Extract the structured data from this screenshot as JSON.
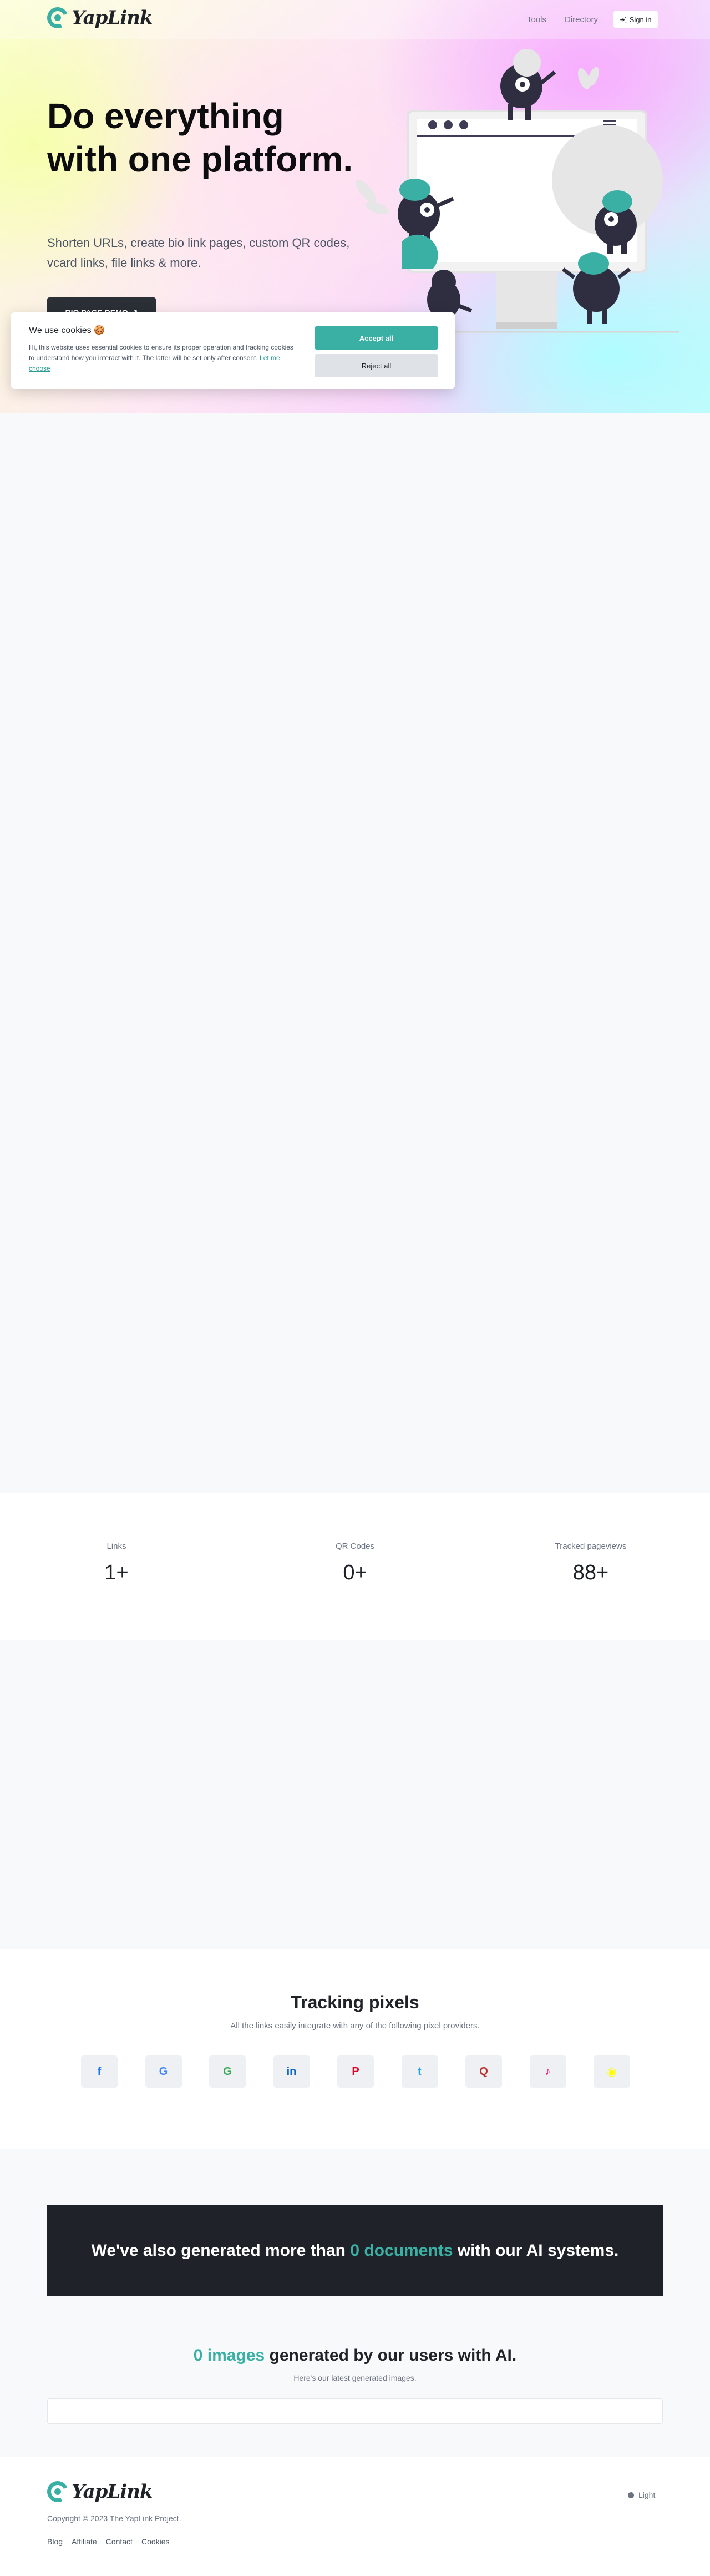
{
  "brand": {
    "name": "YapLink",
    "accent_color": "#3ab0a4",
    "dark_color": "#1f2329"
  },
  "nav": {
    "tools": "Tools",
    "directory": "Directory",
    "signin_icon": "sign-in-icon",
    "signin": "Sign in"
  },
  "hero": {
    "title": "Do everything with one platform.",
    "subtitle": "Shorten URLs, create bio link pages, custom QR codes, vcard links, file links & more.",
    "demo_button": "BIO PAGE DEMO",
    "demo_icon": "external-link-icon"
  },
  "cookie": {
    "title": "We use cookies 🍪",
    "text": "Hi, this website uses essential cookies to ensure its proper operation and tracking cookies to understand how you interact with it. The latter will be set only after consent.",
    "link": "Let me choose",
    "accept": "Accept all",
    "reject": "Reject all"
  },
  "stats": [
    {
      "label": "Links",
      "value": "1+"
    },
    {
      "label": "QR Codes",
      "value": "0+"
    },
    {
      "label": "Tracked pageviews",
      "value": "88+"
    }
  ],
  "pixels": {
    "title": "Tracking pixels",
    "subtitle": "All the links easily integrate with any of the following pixel providers.",
    "providers": [
      {
        "name": "facebook-icon",
        "glyph": "f",
        "color": "#1877f2"
      },
      {
        "name": "google-analytics-icon",
        "glyph": "G",
        "color": "#4285f4"
      },
      {
        "name": "google-tag-manager-icon",
        "glyph": "G",
        "color": "#34a853"
      },
      {
        "name": "linkedin-icon",
        "glyph": "in",
        "color": "#0a66c2"
      },
      {
        "name": "pinterest-icon",
        "glyph": "P",
        "color": "#e60023"
      },
      {
        "name": "twitter-icon",
        "glyph": "t",
        "color": "#1da1f2"
      },
      {
        "name": "quora-icon",
        "glyph": "Q",
        "color": "#b92b27"
      },
      {
        "name": "tiktok-icon",
        "glyph": "♪",
        "color": "#ff0050"
      },
      {
        "name": "snapchat-icon",
        "glyph": "◉",
        "color": "#fffc00"
      }
    ]
  },
  "ai": {
    "documents_pre": "We've also generated more than",
    "documents_count": "0 documents",
    "documents_post": "with our AI systems.",
    "images_count": "0 images",
    "images_post": "generated by our users with AI.",
    "images_sub": "Here's our latest generated images."
  },
  "footer": {
    "copyright": "Copyright © 2023 The YapLink Project.",
    "links": [
      "Blog",
      "Affiliate",
      "Contact",
      "Cookies"
    ],
    "theme": "Light"
  }
}
